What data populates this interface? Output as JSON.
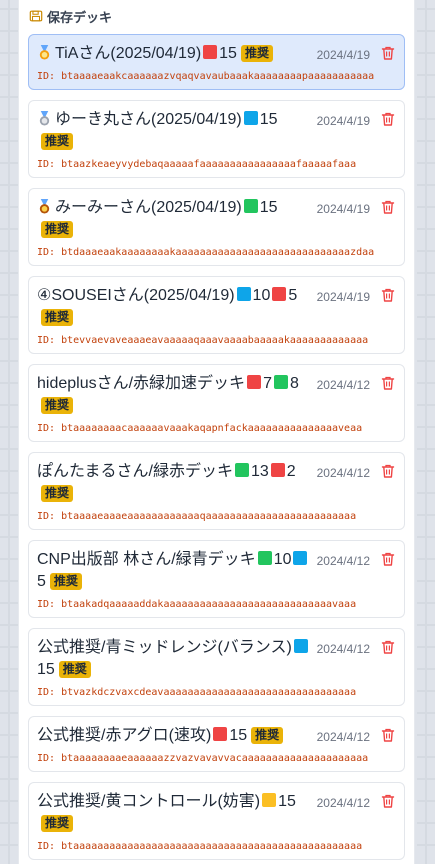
{
  "section": {
    "title": "保存デッキ",
    "icon": "folder-icon"
  },
  "colors": {
    "red": "#ef4444",
    "blue": "#0ea5e9",
    "green": "#22c55e",
    "yellow": "#fbbf24",
    "badge": "#eab308",
    "id_text": "#c2410c",
    "trash": "#ef4444"
  },
  "decks": [
    {
      "medal": "gold",
      "name": "TiAさん(2025/04/19)",
      "counts": [
        {
          "color": "red",
          "count": "15"
        }
      ],
      "badge": "推奨",
      "date": "2024/4/19",
      "id_label": "ID:",
      "id": "btaaaaeaakcaaaaaazvqaqvavaubaaakaaaaaaaapaaaaaaaaaaa",
      "selected": true
    },
    {
      "medal": "silver",
      "name": "ゆーき丸さん(2025/04/19)",
      "counts": [
        {
          "color": "blue",
          "count": "15"
        }
      ],
      "badge": "推奨",
      "date": "2024/4/19",
      "id_label": "ID:",
      "id": "btaazkeaeyvydebaqaaaaafaaaaaaaaaaaaaaaafaaaaafaaa",
      "selected": false
    },
    {
      "medal": "bronze",
      "name": "みーみーさん(2025/04/19)",
      "counts": [
        {
          "color": "green",
          "count": "15"
        }
      ],
      "badge": "推奨",
      "date": "2024/4/19",
      "id_label": "ID:",
      "id": "btdaaaeaakaaaaaaaakaaaaaaaaaaaaaaaaaaaaaaaaaaaaazdaa",
      "selected": false
    },
    {
      "medal": "",
      "name": "④SOUSEIさん(2025/04/19)",
      "counts": [
        {
          "color": "blue",
          "count": "10"
        },
        {
          "color": "red",
          "count": "5"
        }
      ],
      "badge": "推奨",
      "date": "2024/4/19",
      "id_label": "ID:",
      "id": "btevvaevaveaaaeavaaaaaqaaavaaaabaaaaakaaaaaaaaaaaaa",
      "selected": false
    },
    {
      "medal": "",
      "name": "hideplusさん/赤緑加速デッキ",
      "counts": [
        {
          "color": "red",
          "count": "7"
        },
        {
          "color": "green",
          "count": "8"
        }
      ],
      "badge": "推奨",
      "date": "2024/4/12",
      "id_label": "ID:",
      "id": "btaaaaaaaacaaaaaavaaakaqapnfackaaaaaaaaaaaaaaaveaa",
      "selected": false
    },
    {
      "medal": "",
      "name": "ぽんたまるさん/緑赤デッキ",
      "counts": [
        {
          "color": "green",
          "count": "13"
        },
        {
          "color": "red",
          "count": "2"
        }
      ],
      "badge": "推奨",
      "date": "2024/4/12",
      "id_label": "ID:",
      "id": "btaaaaeaaaeaaaaaaaaaaaaqaaaaaaaaaaaaaaaaaaaaaaaaa",
      "selected": false
    },
    {
      "medal": "",
      "name": "CNP出版部 林さん/緑青デッキ",
      "counts": [
        {
          "color": "green",
          "count": "10"
        },
        {
          "color": "blue",
          "count": "5"
        }
      ],
      "badge": "推奨",
      "date": "2024/4/12",
      "id_label": "ID:",
      "id": "btaakadqaaaaaddakaaaaaaaaaaaaaaaaaaaaaaaaaaaavaaa",
      "selected": false
    },
    {
      "medal": "",
      "name": "公式推奨/青ミッドレンジ(バランス)",
      "counts": [
        {
          "color": "blue",
          "count": "15"
        }
      ],
      "badge": "推奨",
      "date": "2024/4/12",
      "id_label": "ID:",
      "id": "btvazkdczvaxcdeavaaaaaaaaaaaaaaaaaaaaaaaaaaaaaaaa",
      "selected": false
    },
    {
      "medal": "",
      "name": "公式推奨/赤アグロ(速攻)",
      "counts": [
        {
          "color": "red",
          "count": "15"
        }
      ],
      "badge": "推奨",
      "date": "2024/4/12",
      "id_label": "ID:",
      "id": "btaaaaaaaaeaaaaaazzvazvavavvacaaaaaaaaaaaaaaaaaaaaa",
      "selected": false
    },
    {
      "medal": "",
      "name": "公式推奨/黄コントロール(妨害)",
      "counts": [
        {
          "color": "yellow",
          "count": "15"
        }
      ],
      "badge": "推奨",
      "date": "2024/4/12",
      "id_label": "ID:",
      "id": "btaaaaaaaaaaaaaaaaaaaaaaaaaaaaaaaaaaaaaaaaaaaaaaaa",
      "selected": false
    }
  ]
}
